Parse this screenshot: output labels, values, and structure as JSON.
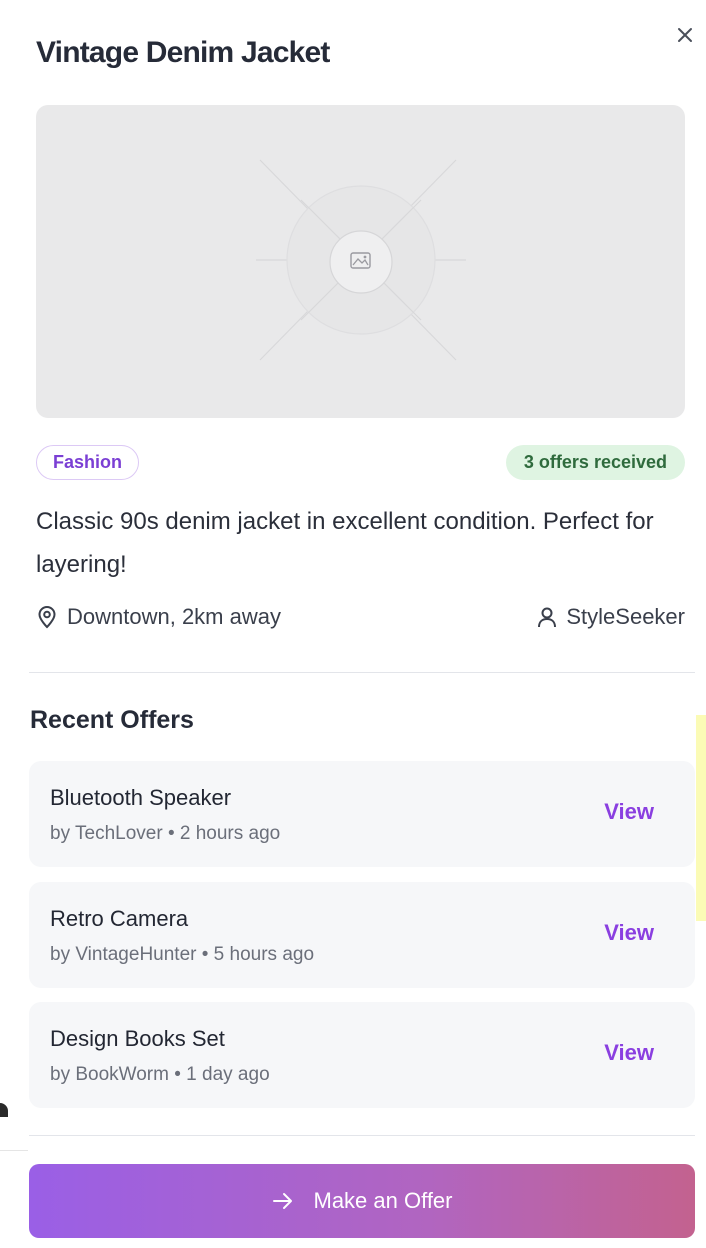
{
  "listing": {
    "title": "Vintage Denim Jacket",
    "image_icon": "image-placeholder-icon",
    "category": "Fashion",
    "offers_badge": "3 offers received",
    "description": "Classic 90s denim jacket in excellent condition. Perfect for layering!",
    "location": "Downtown, 2km away",
    "seller": "StyleSeeker"
  },
  "offers_section": {
    "title": "Recent Offers",
    "items": [
      {
        "name": "Bluetooth Speaker",
        "meta": "by TechLover • 2 hours ago",
        "action": "View"
      },
      {
        "name": "Retro Camera",
        "meta": "by VintageHunter • 5 hours ago",
        "action": "View"
      },
      {
        "name": "Design Books Set",
        "meta": "by BookWorm • 1 day ago",
        "action": "View"
      }
    ]
  },
  "cta": {
    "label": "Make an Offer"
  },
  "colors": {
    "accent": "#8a3fe0",
    "badge_green_bg": "#dff4e2",
    "badge_green_text": "#2f6b3d",
    "gradient_start": "#9a5fe6",
    "gradient_end": "#c3628f"
  }
}
